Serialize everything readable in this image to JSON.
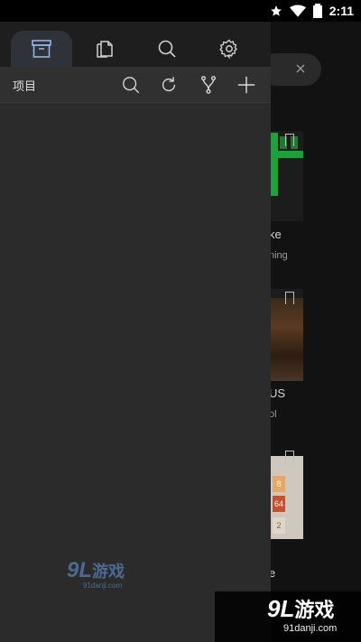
{
  "status_bar": {
    "time": "2:11"
  },
  "drawer": {
    "tabs": [
      {
        "name": "archive",
        "icon": "archive-icon",
        "active": true
      },
      {
        "name": "files",
        "icon": "copy-files-icon",
        "active": false
      },
      {
        "name": "search",
        "icon": "search-icon",
        "active": false
      },
      {
        "name": "settings",
        "icon": "gear-icon",
        "active": false
      }
    ],
    "toolbar": {
      "label": "项目",
      "buttons": [
        "search-icon",
        "refresh-icon",
        "fork-icon",
        "plus-icon"
      ]
    }
  },
  "background": {
    "search_clear": "×",
    "cards": [
      {
        "title": "ke",
        "subtitle": "ning"
      },
      {
        "title": "US",
        "subtitle": "ol"
      },
      {
        "title": "e"
      }
    ],
    "tiles": [
      "8",
      "64",
      "2"
    ]
  },
  "watermark": {
    "logo": "9L",
    "brand": "游戏",
    "url": "91danji.com"
  },
  "colors": {
    "drawer_bg": "#2b2b2b",
    "tab_bar_bg": "#1e1e1e",
    "active_tab": "#2f3238",
    "accent_blue": "#8fb4e8"
  }
}
